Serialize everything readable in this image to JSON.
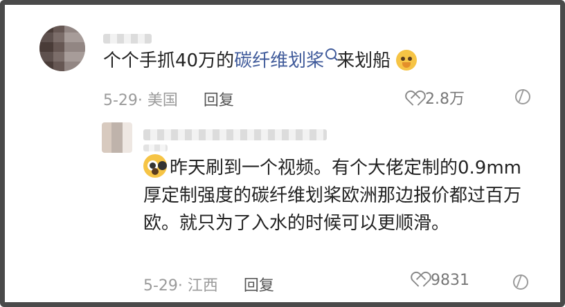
{
  "comments": [
    {
      "text_prefix": "个个手抓40万的",
      "link_text": "碳纤维划桨",
      "text_suffix": "来划船",
      "date_location": "5-29· 美国",
      "reply_label": "回复",
      "likes": "2.8万"
    },
    {
      "text": "昨天刷到一个视频。有个大佬定制的0.9mm厚定制强度的碳纤维划桨欧洲那边报价都过百万欧。就只为了入水的时候可以更顺滑。",
      "date_location": "5-29· 江西",
      "reply_label": "回复",
      "likes": "9831"
    }
  ]
}
